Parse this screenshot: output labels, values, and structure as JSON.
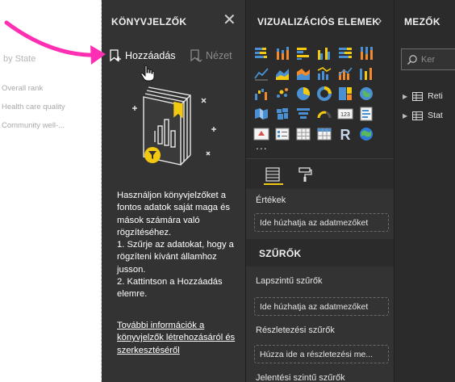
{
  "canvas": {
    "title": "by State",
    "rows": [
      "Overall rank",
      "Health care quality",
      "Community well-..."
    ]
  },
  "bookmarks": {
    "title": "KÖNYVJELZŐK",
    "close_icon": "close-icon",
    "add_label": "Hozzáadás",
    "view_label": "Nézet",
    "info_paragraphs": [
      "Használjon könyvjelzőket a fontos adatok saját maga és mások számára való rögzítéséhez.",
      "1. Szűrje az adatokat, hogy a rögzíteni kívánt államhoz jusson.",
      "2. Kattintson a Hozzáadás elemre."
    ],
    "learn_more_link": "További információk a könyvjelzők létrehozásáról és szerkesztéséről"
  },
  "visualizations": {
    "title": "VIZUALIZÁCIÓS ELEMEK",
    "more_label": "...",
    "values_label": "Értékek",
    "values_drop": "Ide húzhatja az adatmezőket",
    "filters_title": "SZŰRŐK",
    "page_filters_label": "Lapszintű szűrők",
    "page_filters_drop": "Ide húzhatja az adatmezőket",
    "drillthrough_label": "Részletezési szűrők",
    "drillthrough_drop": "Húzza ide a részletezési me...",
    "report_filters_label": "Jelentési szintű szűrők"
  },
  "fields": {
    "title": "MEZŐK",
    "search_placeholder": "Ker",
    "tables": [
      "Reti",
      "Stat"
    ]
  },
  "colors": {
    "accent": "#f2c811",
    "annotation_arrow": "#ff2fb4"
  }
}
